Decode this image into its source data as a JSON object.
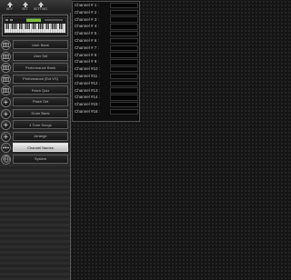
{
  "toolbar": {
    "buttons": [
      {
        "label": "KEY",
        "icon": "arrow-up-icon"
      },
      {
        "label": "SET",
        "icon": "arrow-up-icon"
      },
      {
        "label": "SETTING",
        "icon": "arrow-up-icon"
      }
    ]
  },
  "sidebar": {
    "items": [
      {
        "label": "User Bank",
        "icon": "keyboard-icon",
        "active": false
      },
      {
        "label": "User Set",
        "icon": "keyboard-icon",
        "active": false
      },
      {
        "label": "Performance Bank",
        "icon": "keyboard-icon",
        "active": false
      },
      {
        "label": "Performance (Ext VS)",
        "icon": "keyboard-icon",
        "active": false
      },
      {
        "label": "Patch Quiz",
        "icon": "keyboard-icon",
        "active": false
      },
      {
        "label": "Patch Set",
        "icon": "plus-icon",
        "active": false
      },
      {
        "label": "Drum Bank",
        "icon": "plus-icon",
        "active": false
      },
      {
        "label": "4 Tone Songs",
        "icon": "plus-icon",
        "active": false
      },
      {
        "label": "Arrange",
        "icon": "plus-icon",
        "active": false
      },
      {
        "label": "Channel Names",
        "icon": "dots-icon",
        "active": true
      },
      {
        "label": "System",
        "icon": "globe-icon",
        "active": false
      }
    ]
  },
  "channels": [
    {
      "label": "Channel # 1 :",
      "value": ""
    },
    {
      "label": "Channel # 2 :",
      "value": ""
    },
    {
      "label": "Channel # 3 :",
      "value": ""
    },
    {
      "label": "Channel # 4 :",
      "value": ""
    },
    {
      "label": "Channel # 5 :",
      "value": ""
    },
    {
      "label": "Channel # 6 :",
      "value": ""
    },
    {
      "label": "Channel # 7 :",
      "value": ""
    },
    {
      "label": "Channel # 8 :",
      "value": ""
    },
    {
      "label": "Channel # 9 :",
      "value": ""
    },
    {
      "label": "Channel #10 :",
      "value": ""
    },
    {
      "label": "Channel #11 :",
      "value": ""
    },
    {
      "label": "Channel #12 :",
      "value": ""
    },
    {
      "label": "Channel #13 :",
      "value": ""
    },
    {
      "label": "Channel #14 :",
      "value": ""
    },
    {
      "label": "Channel #15 :",
      "value": ""
    },
    {
      "label": "Channel #16 :",
      "value": ""
    }
  ],
  "colors": {
    "panel_bg": "#2c2c2c",
    "active_button": "#e0e0e0",
    "keyboard_display": "#7fbf3f"
  }
}
